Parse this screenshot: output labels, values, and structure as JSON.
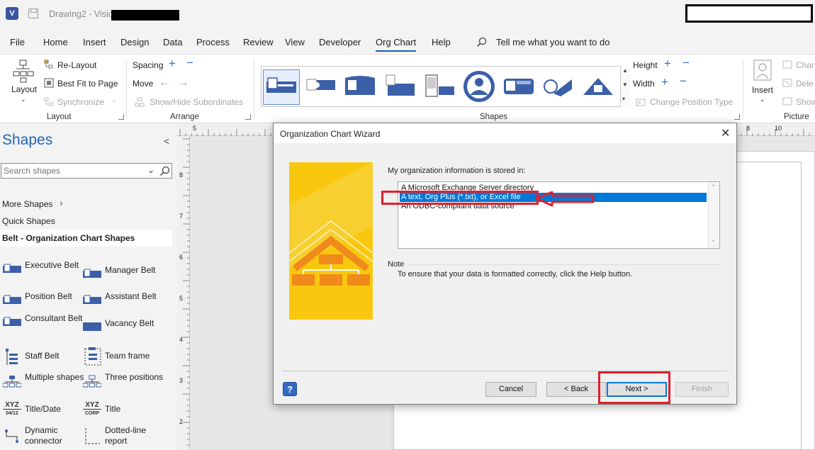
{
  "titlebar": {
    "doc_title": "Drawing2  -  Visio",
    "app_letter": "V"
  },
  "menu": {
    "tabs": [
      "File",
      "Home",
      "Insert",
      "Design",
      "Data",
      "Process",
      "Review",
      "View",
      "Developer",
      "Org Chart",
      "Help"
    ],
    "active_tab": "Org Chart",
    "tell_me": "Tell me what you want to do"
  },
  "ribbon": {
    "layout_group": {
      "layout_label": "Layout",
      "relayout": "Re-Layout",
      "best_fit": "Best Fit to Page",
      "synchronize": "Synchronize",
      "group_label": "Layout"
    },
    "arrange_group": {
      "spacing": "Spacing",
      "move": "Move",
      "show_hide": "Show/Hide Subordinates",
      "group_label": "Arrange"
    },
    "shapes_group": {
      "group_label": "Shapes",
      "height": "Height",
      "width": "Width",
      "change_position_type": "Change Position Type"
    },
    "picture_group": {
      "insert": "Insert",
      "change": "Char",
      "delete": "Dele",
      "show": "Show",
      "group_label": "Picture"
    }
  },
  "shapes_pane": {
    "title": "Shapes",
    "search_placeholder": "Search shapes",
    "more_shapes": "More Shapes",
    "quick_shapes": "Quick Shapes",
    "stencil": "Belt - Organization Chart Shapes",
    "items": [
      {
        "label": "Executive Belt",
        "icon": "executive-belt-icon"
      },
      {
        "label": "Manager Belt",
        "icon": "manager-belt-icon"
      },
      {
        "label": "Position Belt",
        "icon": "position-belt-icon"
      },
      {
        "label": "Assistant Belt",
        "icon": "assistant-belt-icon"
      },
      {
        "label": "Consultant Belt",
        "icon": "consultant-belt-icon"
      },
      {
        "label": "Vacancy Belt",
        "icon": "vacancy-belt-icon"
      },
      {
        "label": "Staff Belt",
        "icon": "staff-belt-icon"
      },
      {
        "label": "Team frame",
        "icon": "team-frame-icon"
      },
      {
        "label": "Multiple shapes",
        "icon": "multiple-shapes-icon"
      },
      {
        "label": "Three positions",
        "icon": "three-positions-icon"
      },
      {
        "label": "Title/Date",
        "icon": "title-date-icon"
      },
      {
        "label": "Title",
        "icon": "title-icon"
      },
      {
        "label": "Dynamic connector",
        "icon": "dynamic-connector-icon"
      },
      {
        "label": "Dotted-line report",
        "icon": "dotted-line-report-icon"
      }
    ],
    "icon_text": {
      "xyz": "XYZ",
      "date": "04/12",
      "corp": "CORP"
    }
  },
  "ruler": {
    "top_marks": [
      "5",
      "8",
      "9",
      "10"
    ],
    "left_marks": [
      "8",
      "7",
      "6",
      "5",
      "4",
      "3",
      "2",
      "1"
    ]
  },
  "dialog": {
    "title": "Organization Chart Wizard",
    "prompt": "My organization information is stored in:",
    "options": [
      "A Microsoft Exchange Server directory",
      "A text, Org Plus (*.txt), or Excel file",
      "An ODBC-compliant data source"
    ],
    "selected_option": "A text, Org Plus (*.txt), or Excel file",
    "note_title": "Note",
    "note_text": "To ensure that your data is formatted correctly, click the Help button.",
    "buttons": {
      "help": "?",
      "cancel": "Cancel",
      "back": "< Back",
      "next": "Next >",
      "finish": "Finish"
    }
  },
  "colors": {
    "accent": "#185abd",
    "selection": "#0078d7",
    "annotation": "#e0202b",
    "wizard_art": "#f7c518"
  }
}
